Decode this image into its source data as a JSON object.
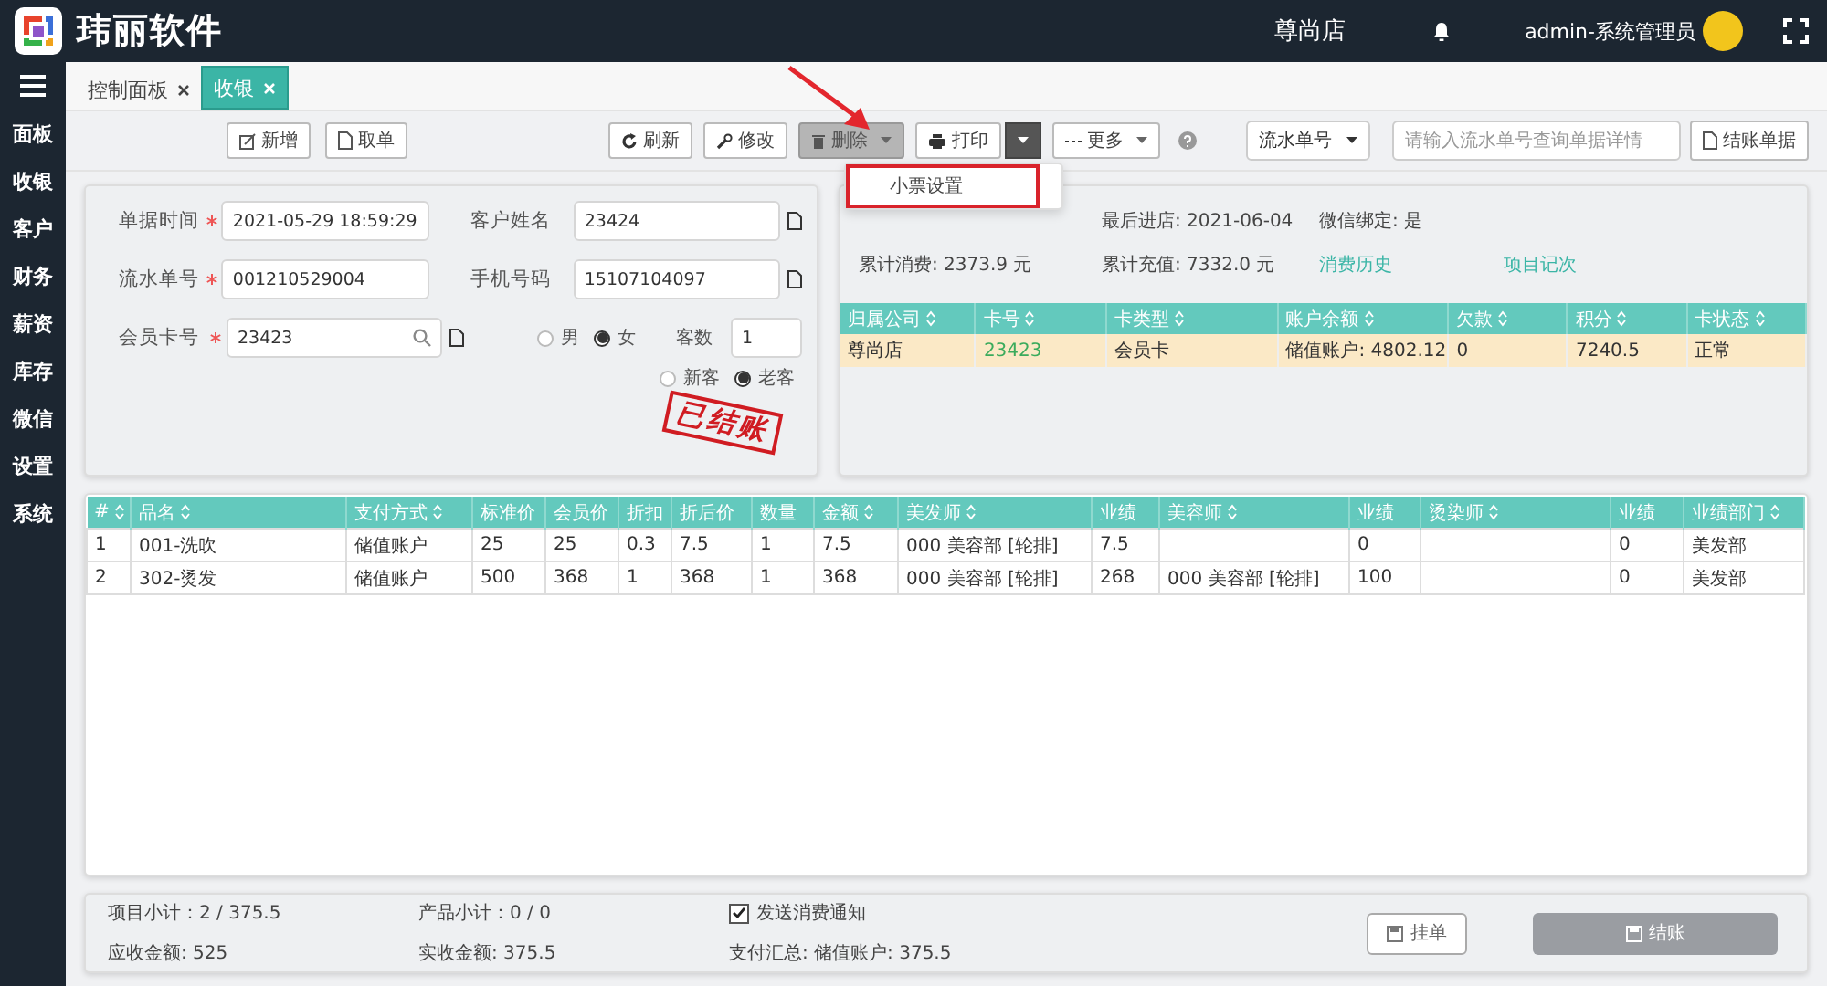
{
  "header": {
    "app_name": "玮丽软件",
    "store": "尊尚店",
    "user": "admin-系统管理员"
  },
  "sidebar": {
    "items": [
      {
        "label": "面板",
        "selected": false
      },
      {
        "label": "收银",
        "selected": false
      },
      {
        "label": "客户",
        "selected": false
      },
      {
        "label": "财务",
        "selected": false
      },
      {
        "label": "薪资",
        "selected": false
      },
      {
        "label": "库存",
        "selected": false
      },
      {
        "label": "微信",
        "selected": false
      },
      {
        "label": "设置",
        "selected": false
      },
      {
        "label": "系统",
        "selected": false
      }
    ]
  },
  "tabs": [
    {
      "label": "控制面板",
      "selected": false
    },
    {
      "label": "收银",
      "selected": true
    }
  ],
  "toolbar": {
    "left_buttons": [
      {
        "label": "新增"
      },
      {
        "label": "取单"
      }
    ],
    "buttons": [
      {
        "label": "刷新",
        "kind": "plain",
        "active": false
      },
      {
        "label": "修改",
        "kind": "plain",
        "active": false
      },
      {
        "label": "删除",
        "kind": "dropdown",
        "active": true
      },
      {
        "label": "打印",
        "kind": "split",
        "active": false
      },
      {
        "label": "更多",
        "kind": "dropdown",
        "active": false
      }
    ],
    "search_type": "流水单号",
    "search": {
      "placeholder": "请输入流水单号查询单据详情"
    },
    "search_button": "结账单据"
  },
  "print_menu": {
    "items": [
      {
        "label": "小票设置",
        "highlighted": true
      }
    ]
  },
  "form": {
    "fields": [
      {
        "label": "单据时间",
        "value": "2021-05-29 18:59:29",
        "required": true
      },
      {
        "label": "客户姓名",
        "value": "23424",
        "required": false
      },
      {
        "label": "流水单号",
        "value": "001210529004",
        "required": true
      },
      {
        "label": "手机号码",
        "value": "15107104097",
        "required": false
      },
      {
        "label": "会员卡号",
        "value": "23423",
        "required": true
      }
    ],
    "gender": [
      {
        "label": "男",
        "selected": false
      },
      {
        "label": "女",
        "selected": true
      }
    ],
    "guest_count": {
      "label": "客数",
      "value": "1"
    },
    "visit": [
      {
        "label": "新客",
        "selected": false
      },
      {
        "label": "老客",
        "selected": true
      }
    ],
    "stamp": "已结账"
  },
  "member": {
    "info": [
      {
        "text": "最后进店: 2021-06-04",
        "kind": "text"
      },
      {
        "text": "微信绑定: 是",
        "kind": "text"
      },
      {
        "text": "累计消费: 2373.9 元",
        "kind": "text"
      },
      {
        "text": "累计充值: 7332.0 元",
        "kind": "text"
      },
      {
        "text": "消费历史",
        "kind": "link"
      },
      {
        "text": "项目记次",
        "kind": "link"
      }
    ],
    "card_table": {
      "columns": [
        "归属公司",
        "卡号",
        "卡类型",
        "账户余额",
        "欠款",
        "积分",
        "卡状态"
      ],
      "rows": [
        {
          "selected": true,
          "cells": [
            "尊尚店",
            "23423",
            "会员卡",
            "储值账户: 4802.12",
            "0",
            "7240.5",
            "正常"
          ]
        }
      ]
    }
  },
  "items_table": {
    "columns": [
      {
        "label": "#",
        "sortable": true
      },
      {
        "label": "品名",
        "sortable": true
      },
      {
        "label": "支付方式",
        "sortable": true
      },
      {
        "label": "标准价",
        "sortable": false
      },
      {
        "label": "会员价",
        "sortable": false
      },
      {
        "label": "折扣",
        "sortable": false
      },
      {
        "label": "折后价",
        "sortable": false
      },
      {
        "label": "数量",
        "sortable": false
      },
      {
        "label": "金额",
        "sortable": true
      },
      {
        "label": "美发师",
        "sortable": true
      },
      {
        "label": "业绩",
        "sortable": false
      },
      {
        "label": "美容师",
        "sortable": true
      },
      {
        "label": "业绩",
        "sortable": false
      },
      {
        "label": "烫染师",
        "sortable": true
      },
      {
        "label": "业绩",
        "sortable": false
      },
      {
        "label": "业绩部门",
        "sortable": true
      }
    ],
    "rows": [
      [
        "1",
        "001-洗吹",
        "储值账户",
        "25",
        "25",
        "0.3",
        "7.5",
        "1",
        "7.5",
        "000 美容部 [轮排]",
        "7.5",
        null,
        "0",
        null,
        "0",
        "美发部"
      ],
      [
        "2",
        "302-烫发",
        "储值账户",
        "500",
        "368",
        "1",
        "368",
        "1",
        "368",
        "000 美容部 [轮排]",
        "268",
        "000 美容部 [轮排]",
        "100",
        null,
        "0",
        "美发部"
      ]
    ]
  },
  "footer": {
    "stats": [
      "项目小计：2 / 375.5",
      "产品小计：0 / 0",
      "应收金额: 525",
      "实收金额: 375.5"
    ],
    "notify": {
      "label": "发送消费通知",
      "checked": true
    },
    "payment_summary": "支付汇总: 储值账户: 375.5",
    "hold_button": "挂单",
    "checkout_button": {
      "label": "结账",
      "disabled": true
    }
  }
}
